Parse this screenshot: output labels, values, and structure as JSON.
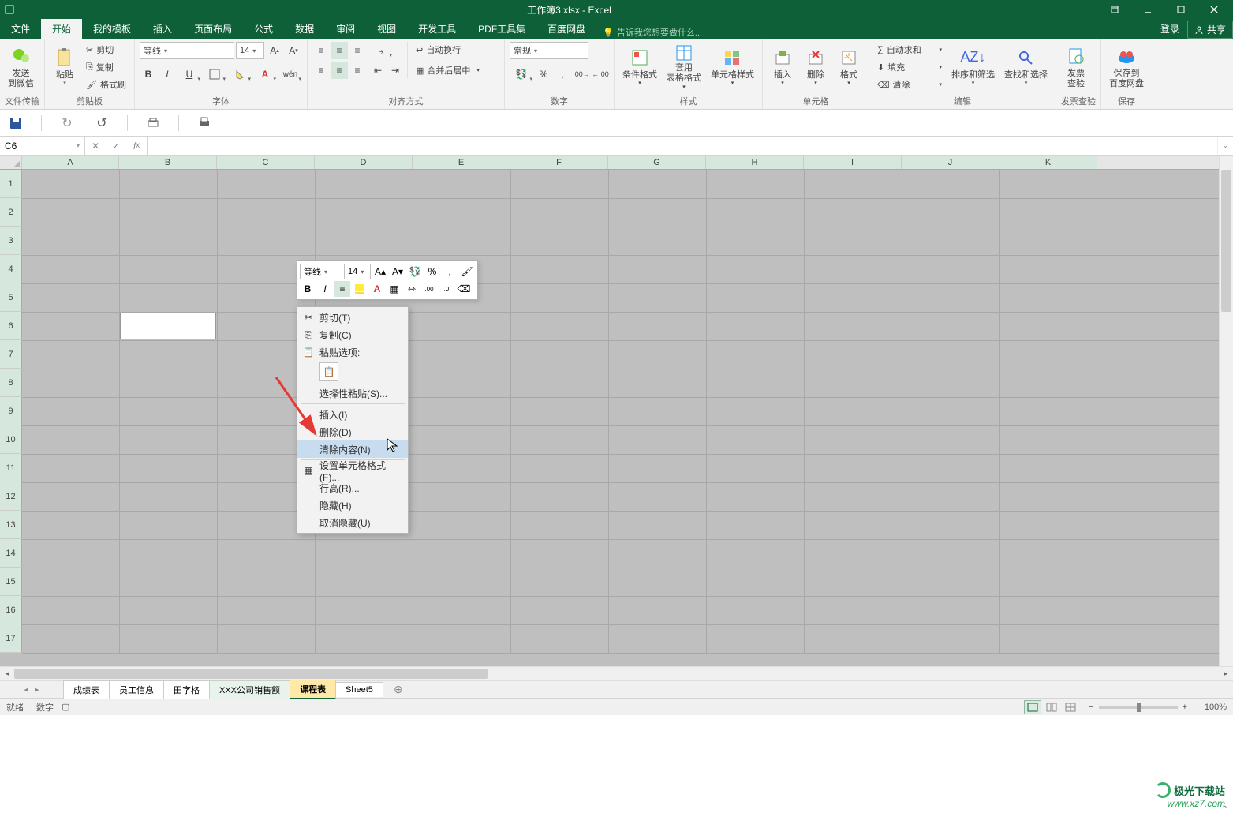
{
  "window": {
    "title": "工作簿3.xlsx - Excel"
  },
  "menubar": {
    "file": "文件",
    "tabs": [
      "开始",
      "我的模板",
      "插入",
      "页面布局",
      "公式",
      "数据",
      "审阅",
      "视图",
      "开发工具",
      "PDF工具集",
      "百度网盘"
    ],
    "active_index": 0,
    "tell_me_placeholder": "告诉我您想要做什么...",
    "login": "登录",
    "share": "共享"
  },
  "ribbon": {
    "clipboard": {
      "send_wechat": "发送\n到微信",
      "paste": "粘贴",
      "cut": "剪切",
      "copy": "复制",
      "format_painter": "格式刷",
      "label": "文件传输",
      "label2": "剪贴板"
    },
    "font": {
      "name": "等线",
      "size": "14",
      "label": "字体"
    },
    "alignment": {
      "wrap": "自动换行",
      "merge": "合并后居中",
      "label": "对齐方式"
    },
    "number": {
      "format": "常规",
      "label": "数字"
    },
    "styles": {
      "cond": "条件格式",
      "table": "套用\n表格格式",
      "cell": "单元格样式",
      "label": "样式"
    },
    "cells": {
      "insert": "插入",
      "delete": "删除",
      "format": "格式",
      "label": "单元格"
    },
    "editing": {
      "autosum": "自动求和",
      "fill": "填充",
      "clear": "清除",
      "sort": "排序和筛选",
      "find": "查找和选择",
      "label": "编辑"
    },
    "invoice": {
      "check": "发票\n查验",
      "label": "发票查验"
    },
    "save": {
      "baidudisk": "保存到\n百度网盘",
      "label": "保存"
    }
  },
  "formula_bar": {
    "cell_ref": "C6",
    "formula": ""
  },
  "grid": {
    "columns": [
      "A",
      "B",
      "C",
      "D",
      "E",
      "F",
      "G",
      "H",
      "I",
      "J",
      "K"
    ],
    "rows": [
      1,
      2,
      3,
      4,
      5,
      6,
      7,
      8,
      9,
      10,
      11,
      12,
      13,
      14,
      15,
      16,
      17
    ]
  },
  "mini_toolbar": {
    "font": "等线",
    "size": "14"
  },
  "context_menu": {
    "cut": "剪切(T)",
    "copy": "复制(C)",
    "paste_options": "粘贴选项:",
    "paste_special": "选择性粘贴(S)...",
    "insert": "插入(I)",
    "delete": "删除(D)",
    "clear_contents": "清除内容(N)",
    "format_cells": "设置单元格格式(F)...",
    "row_height": "行高(R)...",
    "hide": "隐藏(H)",
    "unhide": "取消隐藏(U)"
  },
  "sheet_tabs": {
    "tabs": [
      "成绩表",
      "员工信息",
      "田字格",
      "XXX公司销售额",
      "课程表",
      "Sheet5"
    ],
    "active_index": 4
  },
  "statusbar": {
    "ready": "就绪",
    "mode": "数字",
    "zoom": "100%"
  },
  "watermark": {
    "brand": "极光下载站",
    "url": "www.xz7.com"
  },
  "colors": {
    "excel_green": "#0d6037",
    "accent_light": "#d6e8dd",
    "grey_bg": "#bfbfbf"
  }
}
